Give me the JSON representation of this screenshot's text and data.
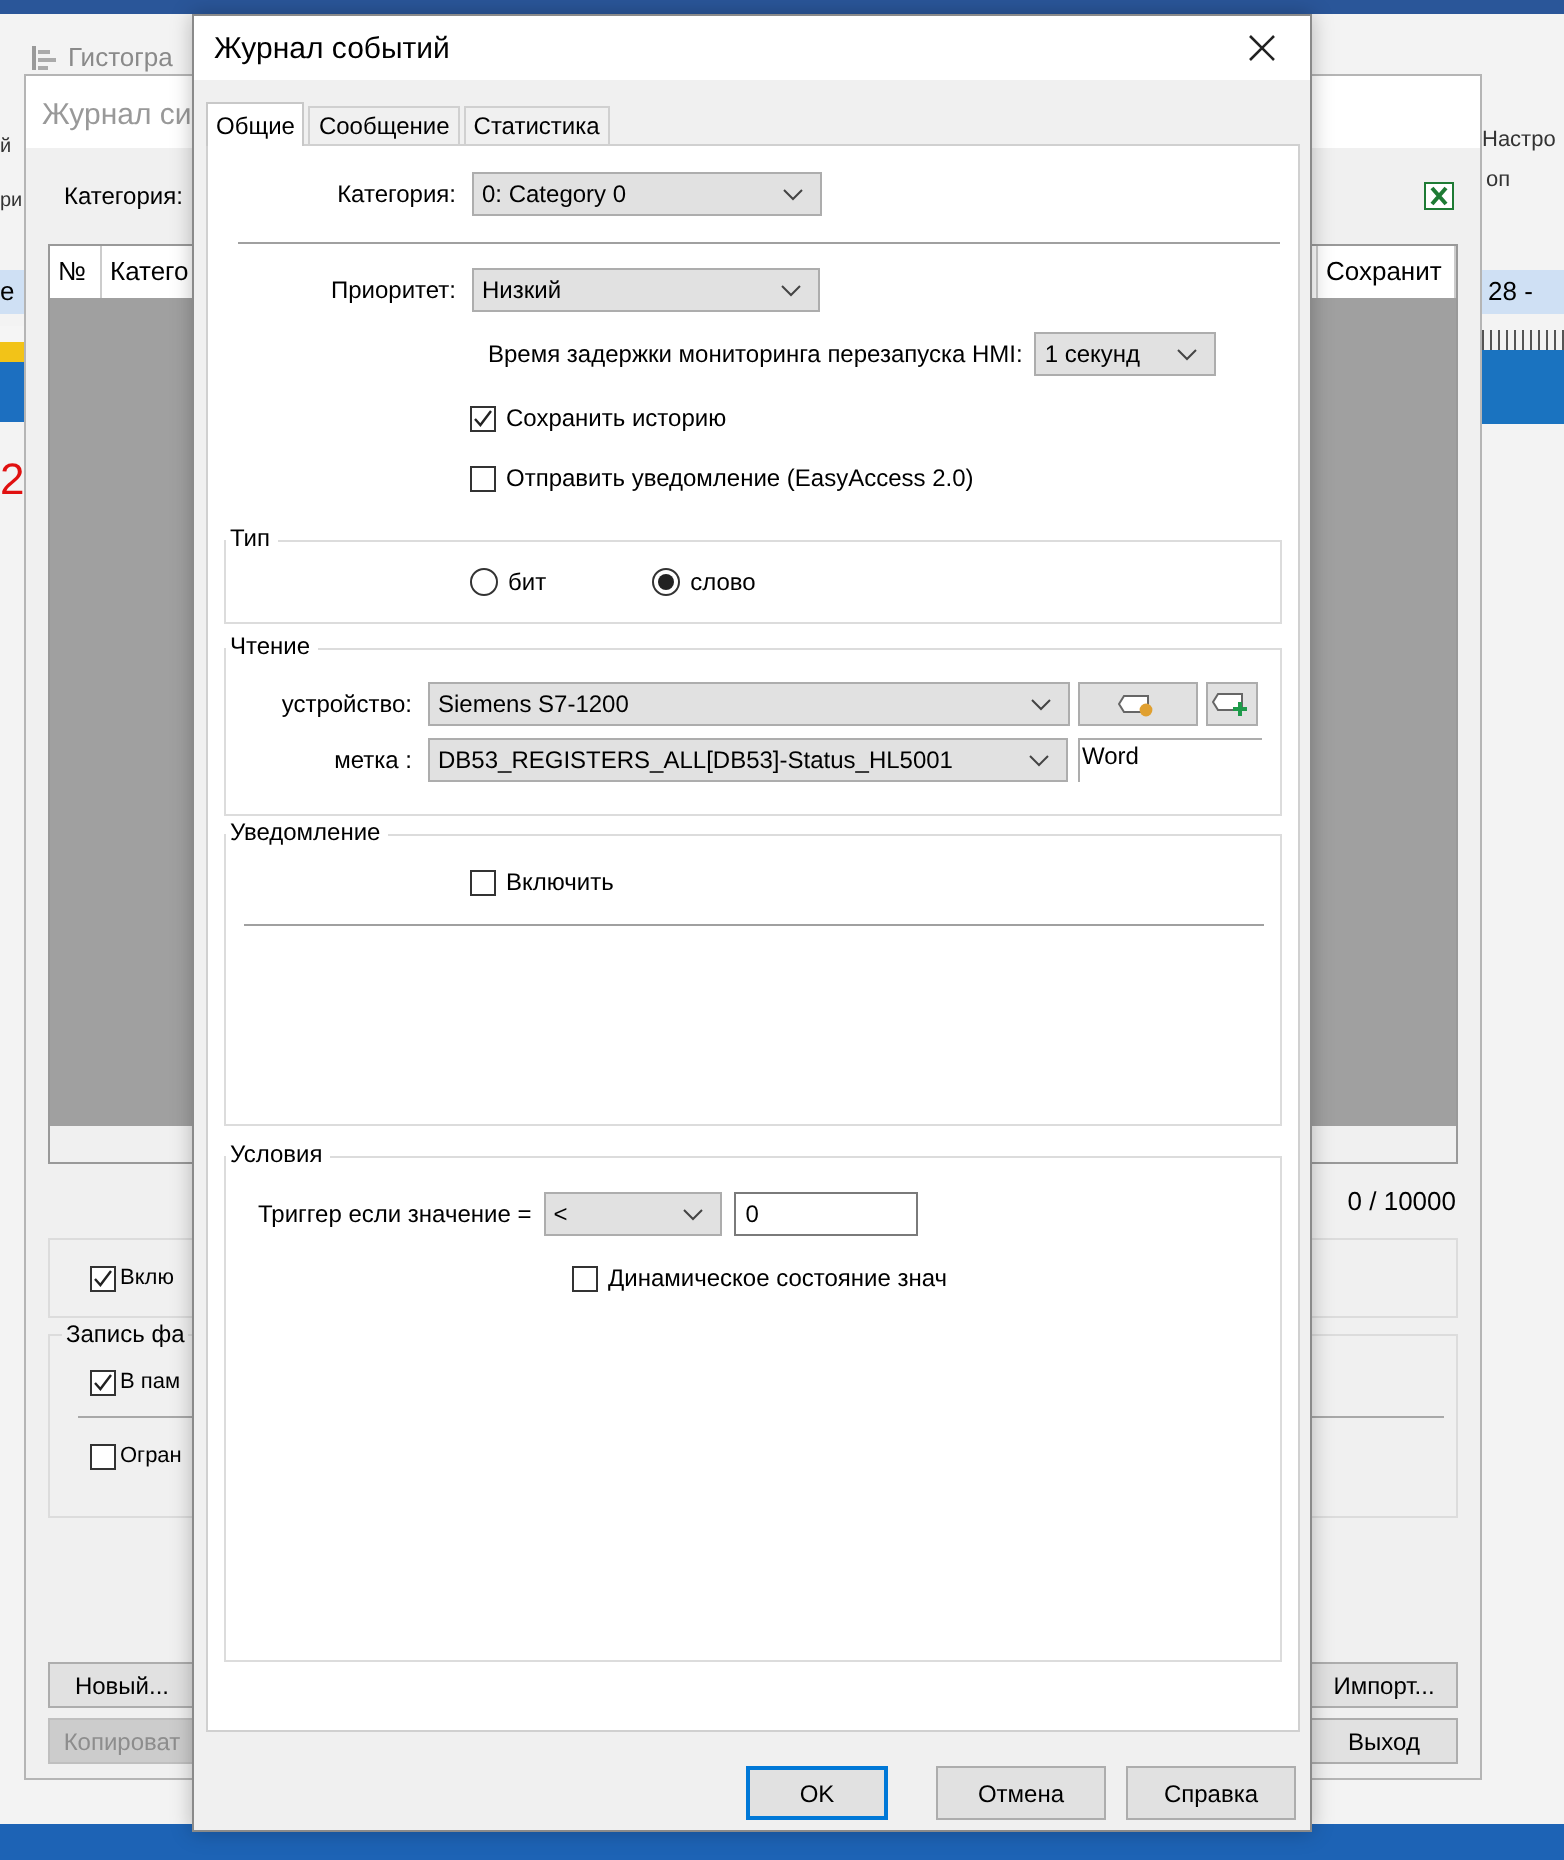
{
  "background_app": {
    "ribbon_item": "Гистогра",
    "left_fragments": [
      "й",
      "ри"
    ],
    "left_tab": "е",
    "left_number": "2",
    "right_fragments": [
      "Настро",
      "оп"
    ],
    "right_tab": "28 -"
  },
  "back_dialog": {
    "title": "Журнал си",
    "category_label": "Категория:",
    "table": {
      "columns": [
        "№",
        "Катего",
        "Сохранит"
      ]
    },
    "counter": "0 / 10000",
    "enable_group": {
      "items": [
        {
          "label": "Вклю",
          "checked": true
        }
      ]
    },
    "record_group": {
      "title": "Запись фа",
      "items": [
        {
          "label": "В пам",
          "checked": true
        },
        {
          "label": "Огран",
          "checked": false
        }
      ]
    },
    "left_buttons": [
      {
        "label": "Новый...",
        "disabled": false
      },
      {
        "label": "Копироват",
        "disabled": true
      }
    ],
    "right_buttons": [
      {
        "label": "Импорт...",
        "disabled": false
      },
      {
        "label": "Выход",
        "disabled": false
      }
    ]
  },
  "dialog": {
    "title": "Журнал событий",
    "tabs": [
      {
        "label": "Общие",
        "selected": true
      },
      {
        "label": "Сообщение",
        "selected": false
      },
      {
        "label": "Статистика",
        "selected": false
      }
    ],
    "category": {
      "label": "Категория:",
      "value": "0: Category 0"
    },
    "priority": {
      "label": "Приоритет:",
      "value": "Низкий"
    },
    "restart_delay": {
      "label": "Время задержки мониторинга перезапуска HMI:",
      "value": "1 секунд"
    },
    "options": [
      {
        "label": "Сохранить историю",
        "checked": true
      },
      {
        "label": "Отправить уведомление (EasyAccess 2.0)",
        "checked": false
      }
    ],
    "type_group": {
      "title": "Тип",
      "options": [
        {
          "label": "бит",
          "selected": false
        },
        {
          "label": "слово",
          "selected": true
        }
      ]
    },
    "read_group": {
      "title": "Чтение",
      "device": {
        "label": "устройство:",
        "value": "Siemens S7-1200"
      },
      "tag": {
        "label": "метка :",
        "value": "DB53_REGISTERS_ALL[DB53]-Status_HL5001",
        "data_type": "Word"
      }
    },
    "notify_group": {
      "title": "Уведомление",
      "enable": {
        "label": "Включить",
        "checked": false
      }
    },
    "conditions_group": {
      "title": "Условия",
      "trigger": {
        "label": "Триггер если значение =",
        "operator": "<",
        "value": "0"
      },
      "dynamic": {
        "label": "Динамическое состояние знач",
        "checked": false
      }
    },
    "buttons": [
      {
        "label": "OK",
        "default": true
      },
      {
        "label": "Отмена",
        "default": false
      },
      {
        "label": "Справка",
        "default": false
      }
    ]
  }
}
